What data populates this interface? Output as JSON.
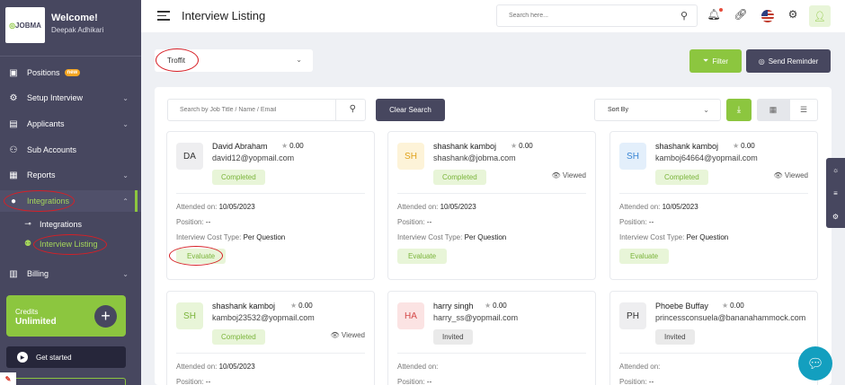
{
  "sidebar": {
    "brand": "JOBMA",
    "welcome": "Welcome!",
    "username": "Deepak Adhikari",
    "items": [
      {
        "label": "Positions",
        "badge": "new"
      },
      {
        "label": "Setup Interview"
      },
      {
        "label": "Applicants"
      },
      {
        "label": "Sub Accounts"
      },
      {
        "label": "Reports"
      },
      {
        "label": "Integrations"
      },
      {
        "label": "Billing"
      }
    ],
    "sub_items": [
      {
        "label": "Integrations"
      },
      {
        "label": "Interview Listing"
      }
    ],
    "credits_label": "Credits",
    "credits_value": "Unlimited",
    "get_started": "Get started"
  },
  "header": {
    "title": "Interview Listing",
    "search_placeholder": "Search here..."
  },
  "filters": {
    "job_value": "Troffit",
    "filter_btn": "Filter",
    "reminder_btn": "Send Reminder",
    "search_placeholder": "Search by Job Title / Name / Email",
    "clear_btn": "Clear Search",
    "sort_label": "Sort By"
  },
  "labels": {
    "attended": "Attended on:",
    "position": "Position:",
    "cost_type": "Interview Cost Type:",
    "evaluate": "Evaluate",
    "viewed": "Viewed"
  },
  "cards": [
    {
      "initials": "DA",
      "name": "David Abraham",
      "rating": "0.00",
      "email": "david12@yopmail.com",
      "status": "Completed",
      "viewed": false,
      "attended": "10/05/2023",
      "position": "--",
      "cost_type": "Per Question",
      "avatar_bg": "#eeeef0",
      "avatar_fg": "#333333"
    },
    {
      "initials": "SH",
      "name": "shashank kamboj",
      "rating": "0.00",
      "email": "shashank@jobma.com",
      "status": "Completed",
      "viewed": true,
      "attended": "10/05/2023",
      "position": "--",
      "cost_type": "Per Question",
      "avatar_bg": "#fdf3d8",
      "avatar_fg": "#e0a21b"
    },
    {
      "initials": "SH",
      "name": "shashank kamboj",
      "rating": "0.00",
      "email": "kamboj64664@yopmail.com",
      "status": "Completed",
      "viewed": true,
      "attended": "10/05/2023",
      "position": "--",
      "cost_type": "Per Question",
      "avatar_bg": "#e3effb",
      "avatar_fg": "#3a86d4"
    },
    {
      "initials": "SH",
      "name": "shashank kamboj",
      "rating": "0.00",
      "email": "kamboj23532@yopmail.com",
      "status": "Completed",
      "viewed": true,
      "attended": "10/05/2023",
      "position": "--",
      "avatar_bg": "#e8f5d8",
      "avatar_fg": "#7ab43a"
    },
    {
      "initials": "HA",
      "name": "harry singh",
      "rating": "0.00",
      "email": "harry_ss@yopmail.com",
      "status": "Invited",
      "viewed": false,
      "attended": "",
      "position": "--",
      "avatar_bg": "#fbe3e3",
      "avatar_fg": "#d44848"
    },
    {
      "initials": "PH",
      "name": "Phoebe Buffay",
      "rating": "0.00",
      "email": "princessconsuela@bananahammock.com",
      "status": "Invited",
      "viewed": false,
      "attended": "",
      "position": "--",
      "avatar_bg": "#eeeef0",
      "avatar_fg": "#333333"
    }
  ],
  "colors": {
    "accent": "#8cc63f",
    "sidebar": "#47475f",
    "chat": "#139fbf"
  }
}
